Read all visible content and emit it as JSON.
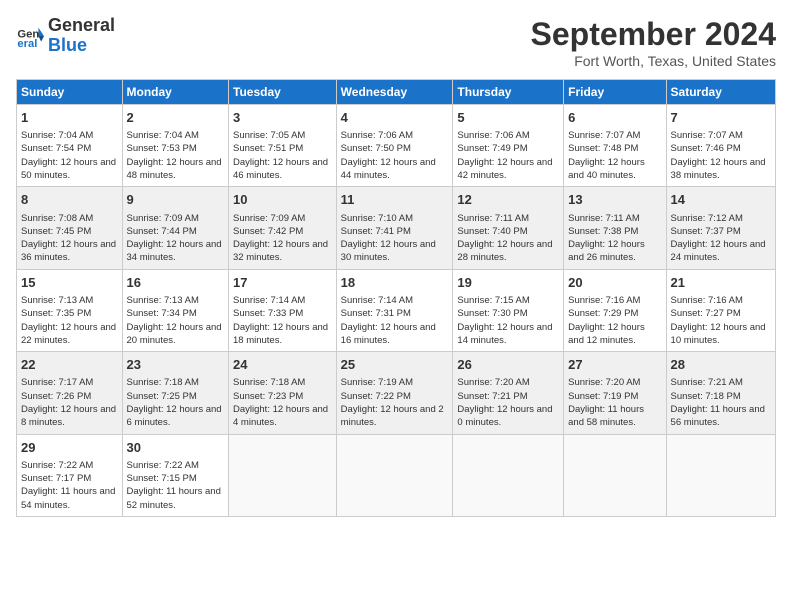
{
  "header": {
    "logo_line1": "General",
    "logo_line2": "Blue",
    "month_title": "September 2024",
    "location": "Fort Worth, Texas, United States"
  },
  "days_of_week": [
    "Sunday",
    "Monday",
    "Tuesday",
    "Wednesday",
    "Thursday",
    "Friday",
    "Saturday"
  ],
  "weeks": [
    [
      {
        "day": "1",
        "sunrise": "Sunrise: 7:04 AM",
        "sunset": "Sunset: 7:54 PM",
        "daylight": "Daylight: 12 hours and 50 minutes."
      },
      {
        "day": "2",
        "sunrise": "Sunrise: 7:04 AM",
        "sunset": "Sunset: 7:53 PM",
        "daylight": "Daylight: 12 hours and 48 minutes."
      },
      {
        "day": "3",
        "sunrise": "Sunrise: 7:05 AM",
        "sunset": "Sunset: 7:51 PM",
        "daylight": "Daylight: 12 hours and 46 minutes."
      },
      {
        "day": "4",
        "sunrise": "Sunrise: 7:06 AM",
        "sunset": "Sunset: 7:50 PM",
        "daylight": "Daylight: 12 hours and 44 minutes."
      },
      {
        "day": "5",
        "sunrise": "Sunrise: 7:06 AM",
        "sunset": "Sunset: 7:49 PM",
        "daylight": "Daylight: 12 hours and 42 minutes."
      },
      {
        "day": "6",
        "sunrise": "Sunrise: 7:07 AM",
        "sunset": "Sunset: 7:48 PM",
        "daylight": "Daylight: 12 hours and 40 minutes."
      },
      {
        "day": "7",
        "sunrise": "Sunrise: 7:07 AM",
        "sunset": "Sunset: 7:46 PM",
        "daylight": "Daylight: 12 hours and 38 minutes."
      }
    ],
    [
      {
        "day": "8",
        "sunrise": "Sunrise: 7:08 AM",
        "sunset": "Sunset: 7:45 PM",
        "daylight": "Daylight: 12 hours and 36 minutes."
      },
      {
        "day": "9",
        "sunrise": "Sunrise: 7:09 AM",
        "sunset": "Sunset: 7:44 PM",
        "daylight": "Daylight: 12 hours and 34 minutes."
      },
      {
        "day": "10",
        "sunrise": "Sunrise: 7:09 AM",
        "sunset": "Sunset: 7:42 PM",
        "daylight": "Daylight: 12 hours and 32 minutes."
      },
      {
        "day": "11",
        "sunrise": "Sunrise: 7:10 AM",
        "sunset": "Sunset: 7:41 PM",
        "daylight": "Daylight: 12 hours and 30 minutes."
      },
      {
        "day": "12",
        "sunrise": "Sunrise: 7:11 AM",
        "sunset": "Sunset: 7:40 PM",
        "daylight": "Daylight: 12 hours and 28 minutes."
      },
      {
        "day": "13",
        "sunrise": "Sunrise: 7:11 AM",
        "sunset": "Sunset: 7:38 PM",
        "daylight": "Daylight: 12 hours and 26 minutes."
      },
      {
        "day": "14",
        "sunrise": "Sunrise: 7:12 AM",
        "sunset": "Sunset: 7:37 PM",
        "daylight": "Daylight: 12 hours and 24 minutes."
      }
    ],
    [
      {
        "day": "15",
        "sunrise": "Sunrise: 7:13 AM",
        "sunset": "Sunset: 7:35 PM",
        "daylight": "Daylight: 12 hours and 22 minutes."
      },
      {
        "day": "16",
        "sunrise": "Sunrise: 7:13 AM",
        "sunset": "Sunset: 7:34 PM",
        "daylight": "Daylight: 12 hours and 20 minutes."
      },
      {
        "day": "17",
        "sunrise": "Sunrise: 7:14 AM",
        "sunset": "Sunset: 7:33 PM",
        "daylight": "Daylight: 12 hours and 18 minutes."
      },
      {
        "day": "18",
        "sunrise": "Sunrise: 7:14 AM",
        "sunset": "Sunset: 7:31 PM",
        "daylight": "Daylight: 12 hours and 16 minutes."
      },
      {
        "day": "19",
        "sunrise": "Sunrise: 7:15 AM",
        "sunset": "Sunset: 7:30 PM",
        "daylight": "Daylight: 12 hours and 14 minutes."
      },
      {
        "day": "20",
        "sunrise": "Sunrise: 7:16 AM",
        "sunset": "Sunset: 7:29 PM",
        "daylight": "Daylight: 12 hours and 12 minutes."
      },
      {
        "day": "21",
        "sunrise": "Sunrise: 7:16 AM",
        "sunset": "Sunset: 7:27 PM",
        "daylight": "Daylight: 12 hours and 10 minutes."
      }
    ],
    [
      {
        "day": "22",
        "sunrise": "Sunrise: 7:17 AM",
        "sunset": "Sunset: 7:26 PM",
        "daylight": "Daylight: 12 hours and 8 minutes."
      },
      {
        "day": "23",
        "sunrise": "Sunrise: 7:18 AM",
        "sunset": "Sunset: 7:25 PM",
        "daylight": "Daylight: 12 hours and 6 minutes."
      },
      {
        "day": "24",
        "sunrise": "Sunrise: 7:18 AM",
        "sunset": "Sunset: 7:23 PM",
        "daylight": "Daylight: 12 hours and 4 minutes."
      },
      {
        "day": "25",
        "sunrise": "Sunrise: 7:19 AM",
        "sunset": "Sunset: 7:22 PM",
        "daylight": "Daylight: 12 hours and 2 minutes."
      },
      {
        "day": "26",
        "sunrise": "Sunrise: 7:20 AM",
        "sunset": "Sunset: 7:21 PM",
        "daylight": "Daylight: 12 hours and 0 minutes."
      },
      {
        "day": "27",
        "sunrise": "Sunrise: 7:20 AM",
        "sunset": "Sunset: 7:19 PM",
        "daylight": "Daylight: 11 hours and 58 minutes."
      },
      {
        "day": "28",
        "sunrise": "Sunrise: 7:21 AM",
        "sunset": "Sunset: 7:18 PM",
        "daylight": "Daylight: 11 hours and 56 minutes."
      }
    ],
    [
      {
        "day": "29",
        "sunrise": "Sunrise: 7:22 AM",
        "sunset": "Sunset: 7:17 PM",
        "daylight": "Daylight: 11 hours and 54 minutes."
      },
      {
        "day": "30",
        "sunrise": "Sunrise: 7:22 AM",
        "sunset": "Sunset: 7:15 PM",
        "daylight": "Daylight: 11 hours and 52 minutes."
      },
      null,
      null,
      null,
      null,
      null
    ]
  ]
}
